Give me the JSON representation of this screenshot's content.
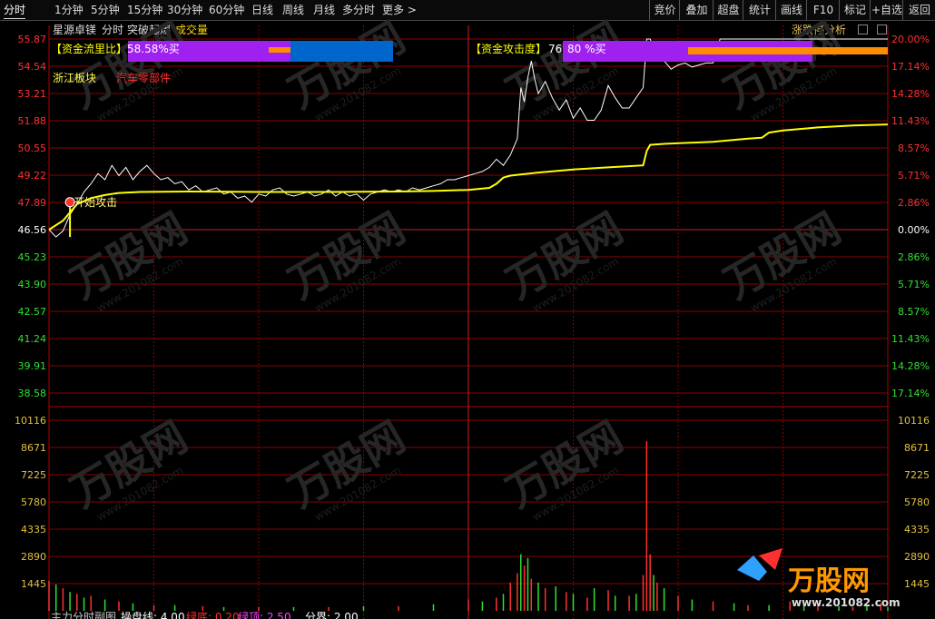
{
  "tabs": [
    {
      "label": "分时",
      "active": true
    },
    {
      "label": "1分钟"
    },
    {
      "label": "5分钟"
    },
    {
      "label": "15分钟"
    },
    {
      "label": "30分钟"
    },
    {
      "label": "60分钟"
    },
    {
      "label": "日线"
    },
    {
      "label": "周线"
    },
    {
      "label": "月线"
    },
    {
      "label": "多分时"
    },
    {
      "label": "更多 >"
    }
  ],
  "right_buttons": [
    "竞价",
    "叠加",
    "超盘",
    "统计",
    "画线",
    "F10",
    "标记",
    "+自选",
    "返回"
  ],
  "info": {
    "stock_name": "星源卓镁",
    "view": "分时",
    "indicator": "突破起爆",
    "volume_label": "成交量",
    "limit_analysis": "涨跌停分析"
  },
  "overlays": {
    "fund_flow_label": "【资金流里比】",
    "fund_flow_value": "58.58%买",
    "fund_attack_label": "【资金攻击度】",
    "fund_attack_value": "76",
    "fund_attack_value2": "80 %买",
    "sector": "浙江板块",
    "industry": "汽车零部件",
    "signal": "开始攻击"
  },
  "bottom": {
    "title": "主力分时副图",
    "line1": "操盘线: 4.00",
    "line2": "绿底: 0.20",
    "line3": "绿顶: 2.50",
    "line4": "分界: 2.00"
  },
  "watermark": {
    "brand": "万股网",
    "site": "www.201082.com"
  },
  "colors": {
    "up": "#ff3030",
    "down": "#30e030",
    "price": "#ffffff",
    "avg": "#ffff00",
    "grid": "#8b0000"
  },
  "chart_data": {
    "type": "line",
    "price_axis_labels": [
      "55.87",
      "54.54",
      "53.21",
      "51.88",
      "50.55",
      "49.22",
      "47.89",
      "46.56",
      "45.23",
      "43.90",
      "42.57",
      "41.24",
      "39.91",
      "38.58"
    ],
    "pct_axis_labels": [
      "20.00%",
      "17.14%",
      "14.28%",
      "11.43%",
      "8.57%",
      "5.71%",
      "2.86%",
      "0.00%",
      "2.86%",
      "5.71%",
      "8.57%",
      "11.43%",
      "14.28%",
      "17.14%"
    ],
    "volume_axis_labels": [
      "10116",
      "8671",
      "7225",
      "5780",
      "4335",
      "2890",
      "1445"
    ],
    "prev_close": 46.56,
    "ylim": [
      37.25,
      55.87
    ],
    "volume_max": 11561,
    "minutes_total": 240,
    "price": [
      [
        0,
        46.56
      ],
      [
        2,
        46.2
      ],
      [
        4,
        46.5
      ],
      [
        6,
        47.3
      ],
      [
        8,
        47.8
      ],
      [
        10,
        48.4
      ],
      [
        12,
        48.8
      ],
      [
        14,
        49.3
      ],
      [
        16,
        49.0
      ],
      [
        18,
        49.7
      ],
      [
        20,
        49.2
      ],
      [
        22,
        49.6
      ],
      [
        24,
        49.0
      ],
      [
        26,
        49.4
      ],
      [
        28,
        49.7
      ],
      [
        30,
        49.3
      ],
      [
        32,
        49.0
      ],
      [
        34,
        49.1
      ],
      [
        36,
        48.8
      ],
      [
        38,
        48.9
      ],
      [
        40,
        48.5
      ],
      [
        42,
        48.7
      ],
      [
        44,
        48.4
      ],
      [
        46,
        48.5
      ],
      [
        48,
        48.6
      ],
      [
        50,
        48.3
      ],
      [
        52,
        48.4
      ],
      [
        54,
        48.1
      ],
      [
        56,
        48.2
      ],
      [
        58,
        47.9
      ],
      [
        60,
        48.3
      ],
      [
        62,
        48.2
      ],
      [
        64,
        48.5
      ],
      [
        66,
        48.6
      ],
      [
        68,
        48.3
      ],
      [
        70,
        48.2
      ],
      [
        72,
        48.3
      ],
      [
        74,
        48.4
      ],
      [
        76,
        48.2
      ],
      [
        78,
        48.3
      ],
      [
        80,
        48.5
      ],
      [
        82,
        48.2
      ],
      [
        84,
        48.4
      ],
      [
        86,
        48.2
      ],
      [
        88,
        48.3
      ],
      [
        90,
        48.0
      ],
      [
        92,
        48.3
      ],
      [
        94,
        48.4
      ],
      [
        96,
        48.5
      ],
      [
        98,
        48.4
      ],
      [
        100,
        48.5
      ],
      [
        102,
        48.4
      ],
      [
        104,
        48.6
      ],
      [
        106,
        48.5
      ],
      [
        108,
        48.6
      ],
      [
        110,
        48.7
      ],
      [
        112,
        48.8
      ],
      [
        114,
        49.0
      ],
      [
        116,
        49.0
      ],
      [
        118,
        49.1
      ],
      [
        120,
        49.2
      ],
      [
        122,
        49.3
      ],
      [
        124,
        49.4
      ],
      [
        126,
        49.6
      ],
      [
        128,
        50.0
      ],
      [
        130,
        49.7
      ],
      [
        132,
        50.2
      ],
      [
        134,
        51.0
      ],
      [
        135,
        53.5
      ],
      [
        136,
        52.8
      ],
      [
        137,
        54.0
      ],
      [
        138,
        54.8
      ],
      [
        139,
        53.9
      ],
      [
        140,
        53.2
      ],
      [
        142,
        53.8
      ],
      [
        144,
        53.0
      ],
      [
        146,
        52.4
      ],
      [
        148,
        52.9
      ],
      [
        150,
        52.0
      ],
      [
        152,
        52.5
      ],
      [
        154,
        51.9
      ],
      [
        156,
        51.9
      ],
      [
        158,
        52.4
      ],
      [
        160,
        53.6
      ],
      [
        162,
        53.0
      ],
      [
        164,
        52.5
      ],
      [
        166,
        52.5
      ],
      [
        168,
        53.0
      ],
      [
        170,
        53.5
      ],
      [
        171,
        55.87
      ],
      [
        172,
        55.87
      ],
      [
        174,
        55.0
      ],
      [
        176,
        54.8
      ],
      [
        178,
        54.4
      ],
      [
        180,
        54.6
      ],
      [
        182,
        54.7
      ],
      [
        184,
        54.5
      ],
      [
        186,
        54.6
      ],
      [
        188,
        54.7
      ],
      [
        190,
        54.7
      ],
      [
        192,
        55.87
      ],
      [
        194,
        55.87
      ],
      [
        196,
        55.87
      ],
      [
        198,
        55.87
      ],
      [
        200,
        55.87
      ],
      [
        204,
        55.87
      ],
      [
        208,
        55.87
      ],
      [
        212,
        55.87
      ],
      [
        216,
        55.87
      ],
      [
        220,
        55.87
      ],
      [
        224,
        55.87
      ],
      [
        228,
        55.87
      ],
      [
        232,
        55.87
      ],
      [
        236,
        55.87
      ],
      [
        240,
        55.87
      ]
    ],
    "avg": [
      [
        0,
        46.56
      ],
      [
        4,
        47.0
      ],
      [
        8,
        47.8
      ],
      [
        12,
        48.1
      ],
      [
        16,
        48.25
      ],
      [
        20,
        48.35
      ],
      [
        26,
        48.4
      ],
      [
        40,
        48.42
      ],
      [
        60,
        48.4
      ],
      [
        80,
        48.4
      ],
      [
        100,
        48.42
      ],
      [
        110,
        48.45
      ],
      [
        120,
        48.5
      ],
      [
        126,
        48.6
      ],
      [
        128,
        48.8
      ],
      [
        130,
        49.1
      ],
      [
        132,
        49.2
      ],
      [
        140,
        49.35
      ],
      [
        150,
        49.5
      ],
      [
        160,
        49.6
      ],
      [
        170,
        49.7
      ],
      [
        171,
        50.4
      ],
      [
        172,
        50.7
      ],
      [
        176,
        50.75
      ],
      [
        190,
        50.85
      ],
      [
        200,
        51.0
      ],
      [
        204,
        51.05
      ],
      [
        206,
        51.3
      ],
      [
        210,
        51.4
      ],
      [
        220,
        51.55
      ],
      [
        230,
        51.65
      ],
      [
        240,
        51.7
      ]
    ],
    "volume_red": [
      [
        0,
        1600
      ],
      [
        4,
        1200
      ],
      [
        8,
        900
      ],
      [
        12,
        800
      ],
      [
        20,
        500
      ],
      [
        30,
        300
      ],
      [
        44,
        250
      ],
      [
        60,
        200
      ],
      [
        80,
        200
      ],
      [
        100,
        250
      ],
      [
        120,
        600
      ],
      [
        128,
        700
      ],
      [
        132,
        1500
      ],
      [
        134,
        2000
      ],
      [
        136,
        2400
      ],
      [
        138,
        1700
      ],
      [
        142,
        1200
      ],
      [
        148,
        1000
      ],
      [
        154,
        700
      ],
      [
        160,
        1100
      ],
      [
        166,
        800
      ],
      [
        170,
        1900
      ],
      [
        171,
        9000
      ],
      [
        172,
        3000
      ],
      [
        174,
        1500
      ],
      [
        180,
        800
      ],
      [
        190,
        500
      ],
      [
        200,
        300
      ],
      [
        212,
        500
      ],
      [
        220,
        300
      ],
      [
        230,
        200
      ],
      [
        238,
        400
      ]
    ],
    "volume_green": [
      [
        2,
        1400
      ],
      [
        6,
        1000
      ],
      [
        10,
        700
      ],
      [
        16,
        600
      ],
      [
        24,
        400
      ],
      [
        36,
        300
      ],
      [
        50,
        200
      ],
      [
        70,
        200
      ],
      [
        90,
        250
      ],
      [
        110,
        350
      ],
      [
        124,
        500
      ],
      [
        130,
        900
      ],
      [
        135,
        3000
      ],
      [
        137,
        2800
      ],
      [
        140,
        1500
      ],
      [
        145,
        1300
      ],
      [
        150,
        900
      ],
      [
        156,
        1200
      ],
      [
        162,
        800
      ],
      [
        168,
        900
      ],
      [
        173,
        1900
      ],
      [
        176,
        1200
      ],
      [
        184,
        600
      ],
      [
        196,
        400
      ],
      [
        206,
        300
      ],
      [
        216,
        400
      ],
      [
        226,
        250
      ],
      [
        234,
        300
      ],
      [
        240,
        200
      ]
    ]
  }
}
